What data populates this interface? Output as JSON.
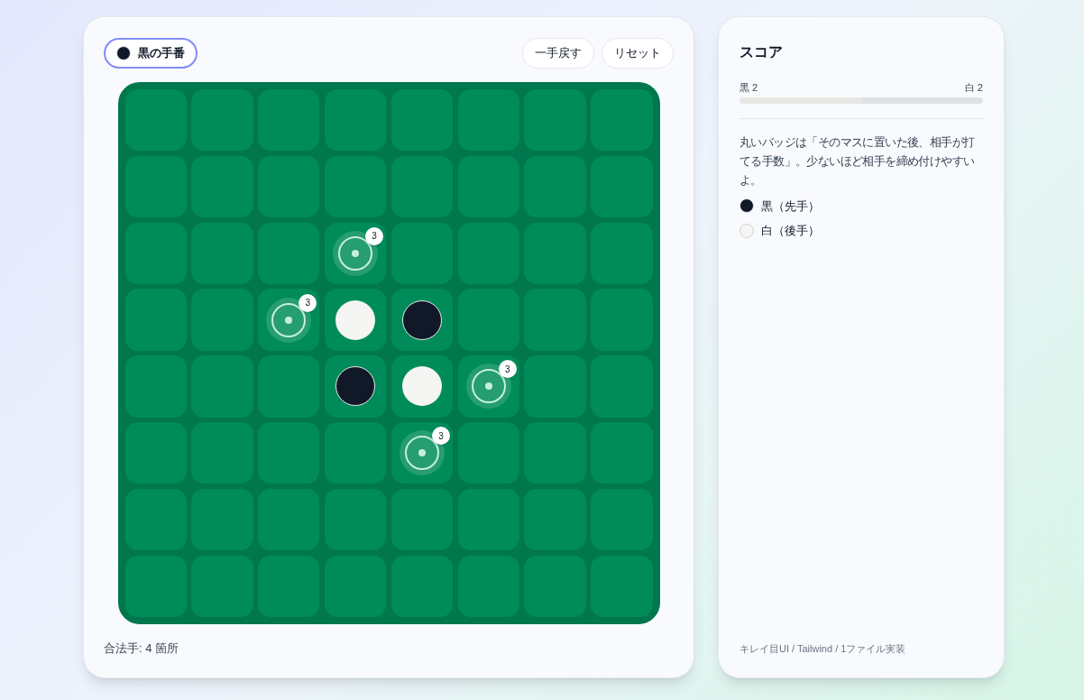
{
  "turn": {
    "label": "黒の手番",
    "kind": "black"
  },
  "buttons": [
    "一手戻す",
    "リセット"
  ],
  "board": [
    [
      {
        "kind": "empty"
      },
      {
        "kind": "empty"
      },
      {
        "kind": "empty"
      },
      {
        "kind": "empty"
      },
      {
        "kind": "empty"
      },
      {
        "kind": "empty"
      },
      {
        "kind": "empty"
      },
      {
        "kind": "empty"
      }
    ],
    [
      {
        "kind": "empty"
      },
      {
        "kind": "empty"
      },
      {
        "kind": "empty"
      },
      {
        "kind": "empty"
      },
      {
        "kind": "empty"
      },
      {
        "kind": "empty"
      },
      {
        "kind": "empty"
      },
      {
        "kind": "empty"
      }
    ],
    [
      {
        "kind": "empty"
      },
      {
        "kind": "empty"
      },
      {
        "kind": "empty"
      },
      {
        "kind": "hint",
        "badge": "3"
      },
      {
        "kind": "empty"
      },
      {
        "kind": "empty"
      },
      {
        "kind": "empty"
      },
      {
        "kind": "empty"
      }
    ],
    [
      {
        "kind": "empty"
      },
      {
        "kind": "empty"
      },
      {
        "kind": "hint",
        "badge": "3"
      },
      {
        "kind": "white"
      },
      {
        "kind": "black"
      },
      {
        "kind": "empty"
      },
      {
        "kind": "empty"
      },
      {
        "kind": "empty"
      }
    ],
    [
      {
        "kind": "empty"
      },
      {
        "kind": "empty"
      },
      {
        "kind": "empty"
      },
      {
        "kind": "black"
      },
      {
        "kind": "white"
      },
      {
        "kind": "hint",
        "badge": "3"
      },
      {
        "kind": "empty"
      },
      {
        "kind": "empty"
      }
    ],
    [
      {
        "kind": "empty"
      },
      {
        "kind": "empty"
      },
      {
        "kind": "empty"
      },
      {
        "kind": "empty"
      },
      {
        "kind": "hint",
        "badge": "3"
      },
      {
        "kind": "empty"
      },
      {
        "kind": "empty"
      },
      {
        "kind": "empty"
      }
    ],
    [
      {
        "kind": "empty"
      },
      {
        "kind": "empty"
      },
      {
        "kind": "empty"
      },
      {
        "kind": "empty"
      },
      {
        "kind": "empty"
      },
      {
        "kind": "empty"
      },
      {
        "kind": "empty"
      },
      {
        "kind": "empty"
      }
    ],
    [
      {
        "kind": "empty"
      },
      {
        "kind": "empty"
      },
      {
        "kind": "empty"
      },
      {
        "kind": "empty"
      },
      {
        "kind": "empty"
      },
      {
        "kind": "empty"
      },
      {
        "kind": "empty"
      },
      {
        "kind": "empty"
      }
    ]
  ],
  "legal_moves": "合法手: 4 箇所",
  "score": {
    "title": "スコア",
    "black_label": "黒 2",
    "white_label": "白 2",
    "level": 0.5
  },
  "note": "丸いバッジは「そのマスに置いた後、相手が打てる手数」。少ないほど相手を締め付けやすいよ。",
  "legend": [
    {
      "label": "黒（先手）",
      "kind": "black"
    },
    {
      "label": "白（後手）",
      "kind": "white"
    }
  ],
  "footer": "キレイ目UI / Tailwind / 1ファイル実装"
}
